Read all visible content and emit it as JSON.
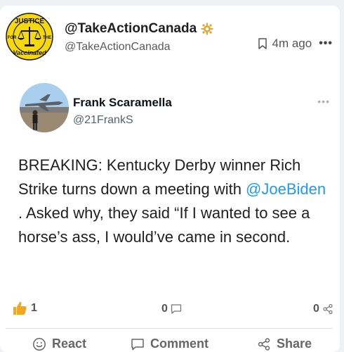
{
  "post": {
    "author_name": "@TakeActionCanada",
    "author_handle": "@TakeActionCanada",
    "time_ago": "4m ago",
    "more": "•••",
    "logo_text": {
      "top": "JUSTICE",
      "left": "FOR",
      "right": "THE",
      "bottom": "Vaccinated"
    }
  },
  "embed": {
    "name": "Frank Scaramella",
    "handle": "@21FrankS",
    "more": "•••",
    "text_before": "BREAKING: Kentucky Derby winner Rich Strike turns down a meeting with ",
    "mention": "@JoeBiden",
    "text_after": " . Asked why, they said “If I wanted to see a horse’s ass, I would’ve came in second."
  },
  "stats": {
    "likes": "1",
    "comments": "0",
    "shares": "0"
  },
  "actions": {
    "react": "React",
    "comment": "Comment",
    "share": "Share"
  },
  "colors": {
    "mention": "#1d9bf0",
    "logo_yellow": "#f5d90a",
    "thumb_orange": "#f4a623"
  }
}
